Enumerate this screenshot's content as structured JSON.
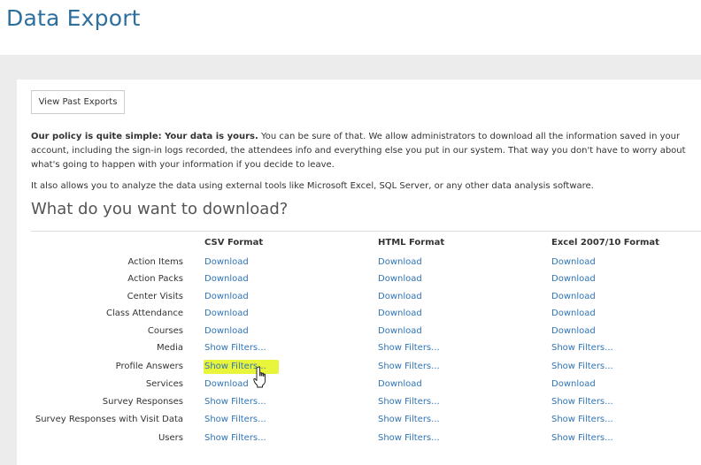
{
  "header": {
    "title": "Data Export"
  },
  "toolbar": {
    "view_past_exports": "View Past Exports"
  },
  "intro": {
    "policy_bold": "Our policy is quite simple: Your data is yours.",
    "policy_rest": " You can be sure of that. We allow administrators to download all the information saved in your account, including the sign-in logs recorded, the attendees info and everything else you put in our system. That way you don't have to worry about what's going to happen with your information if you decide to leave.",
    "also": "It also allows you to analyze the data using external tools like Microsoft Excel, SQL Server, or any other data analysis software."
  },
  "section": {
    "question": "What do you want to download?"
  },
  "columns": [
    "CSV Format",
    "HTML Format",
    "Excel 2007/10 Format"
  ],
  "rows": [
    {
      "label": "Action Items",
      "csv": "Download",
      "html": "Download",
      "excel": "Download"
    },
    {
      "label": "Action Packs",
      "csv": "Download",
      "html": "Download",
      "excel": "Download"
    },
    {
      "label": "Center Visits",
      "csv": "Download",
      "html": "Download",
      "excel": "Download"
    },
    {
      "label": "Class Attendance",
      "csv": "Download",
      "html": "Download",
      "excel": "Download"
    },
    {
      "label": "Courses",
      "csv": "Download",
      "html": "Download",
      "excel": "Download"
    },
    {
      "label": "Media",
      "csv": "Show Filters...",
      "html": "Show Filters...",
      "excel": "Show Filters..."
    },
    {
      "label": "Profile Answers",
      "csv": "Show Filters...",
      "html": "Show Filters...",
      "excel": "Show Filters..."
    },
    {
      "label": "Services",
      "csv": "Download",
      "html": "Download",
      "excel": "Download"
    },
    {
      "label": "Survey Responses",
      "csv": "Show Filters...",
      "html": "Show Filters...",
      "excel": "Show Filters..."
    },
    {
      "label": "Survey Responses with Visit Data",
      "csv": "Show Filters...",
      "html": "Show Filters...",
      "excel": "Show Filters..."
    },
    {
      "label": "Users",
      "csv": "Show Filters...",
      "html": "Show Filters...",
      "excel": "Show Filters..."
    }
  ],
  "colors": {
    "title": "#2e6f9e",
    "link": "#2f74b5",
    "highlight": "#e9f53a",
    "band": "#ececec"
  }
}
